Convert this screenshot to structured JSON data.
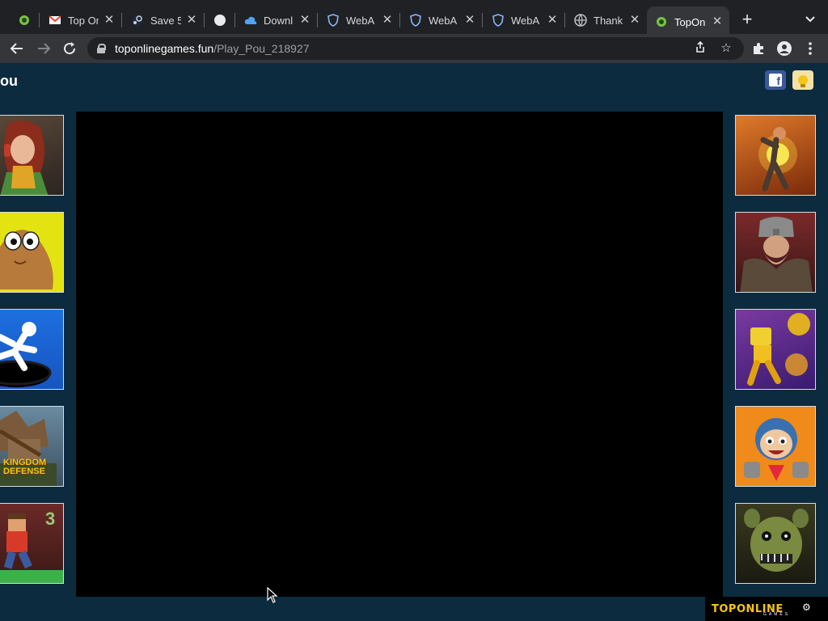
{
  "tabs": [
    {
      "title": "",
      "favicon": "green-circle-icon",
      "active": false
    },
    {
      "title": "Top Or",
      "favicon": "gmail-icon",
      "active": false
    },
    {
      "title": "Save 5",
      "favicon": "steam-icon",
      "active": false
    },
    {
      "title": "",
      "favicon": "white-circle-icon",
      "active": false
    },
    {
      "title": "Downl",
      "favicon": "cloud-icon",
      "active": false
    },
    {
      "title": "WebA",
      "favicon": "shield-icon",
      "active": false
    },
    {
      "title": "WebA",
      "favicon": "shield-icon",
      "active": false
    },
    {
      "title": "WebA",
      "favicon": "shield-icon",
      "active": false
    },
    {
      "title": "Thank",
      "favicon": "globe-icon",
      "active": false
    },
    {
      "title": "TopOn",
      "favicon": "green-circle-icon",
      "active": true
    }
  ],
  "address": {
    "host": "toponlinegames.fun",
    "path": "/Play_Pou_218927"
  },
  "page": {
    "title": "ou",
    "logo_text": "TOPONLINE",
    "logo_sub": "GAMES"
  },
  "thumbs_left": [
    {
      "name": "thumb-girl-headphones",
      "icon": "girl-headphones"
    },
    {
      "name": "thumb-pou",
      "icon": "pou"
    },
    {
      "name": "thumb-stickman-hole",
      "icon": "stickman-fall"
    },
    {
      "name": "thumb-kingdom-defense",
      "icon": "kingdom-defense",
      "label": "KINGDOM DEFENSE"
    },
    {
      "name": "thumb-blocky-runner",
      "icon": "blocky-runner",
      "label": "3"
    }
  ],
  "thumbs_right": [
    {
      "name": "thumb-fire-hero",
      "icon": "fire-hero"
    },
    {
      "name": "thumb-viking",
      "icon": "viking"
    },
    {
      "name": "thumb-robot-run",
      "icon": "robot-run"
    },
    {
      "name": "thumb-helmet-kid",
      "icon": "helmet-kid"
    },
    {
      "name": "thumb-animatronic",
      "icon": "animatronic"
    }
  ],
  "colors": {
    "page_bg": "#0c2b3e",
    "accent": "#f5c518"
  }
}
